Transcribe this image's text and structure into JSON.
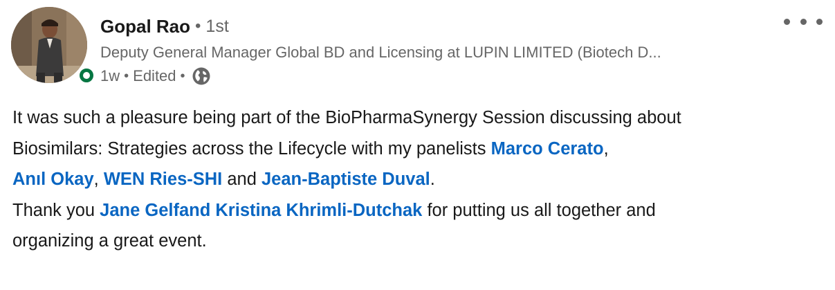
{
  "author": {
    "name": "Gopal Rao",
    "separator": "•",
    "degree": "1st",
    "headline": "Deputy General Manager Global BD and Licensing at LUPIN LIMITED (Biotech D...",
    "time": "1w",
    "edited": "Edited",
    "visibility_icon": "globe-icon",
    "online_color": "#057642"
  },
  "post": {
    "line1": "It was such a pleasure being part of the BioPharmaSynergy Session discussing about",
    "line2_text": "Biosimilars: Strategies across the Lifecycle with my panelists ",
    "mention1": "Marco Cerato",
    "comma1": ",",
    "mention2": "Anıl Okay",
    "comma2": ", ",
    "mention3": "WEN Ries-SHI",
    "and_text": " and ",
    "mention4": "Jean-Baptiste Duval",
    "period": ".",
    "thanks_text": "Thank you ",
    "mention5": "Jane Gelfand",
    "space": " ",
    "mention6": "Kristina Khrimli-Dutchak",
    "after_mentions": " for putting us all together and",
    "line_last": "organizing a great event."
  },
  "colors": {
    "link": "#0a66c2",
    "text": "#191919",
    "muted": "#666666"
  }
}
